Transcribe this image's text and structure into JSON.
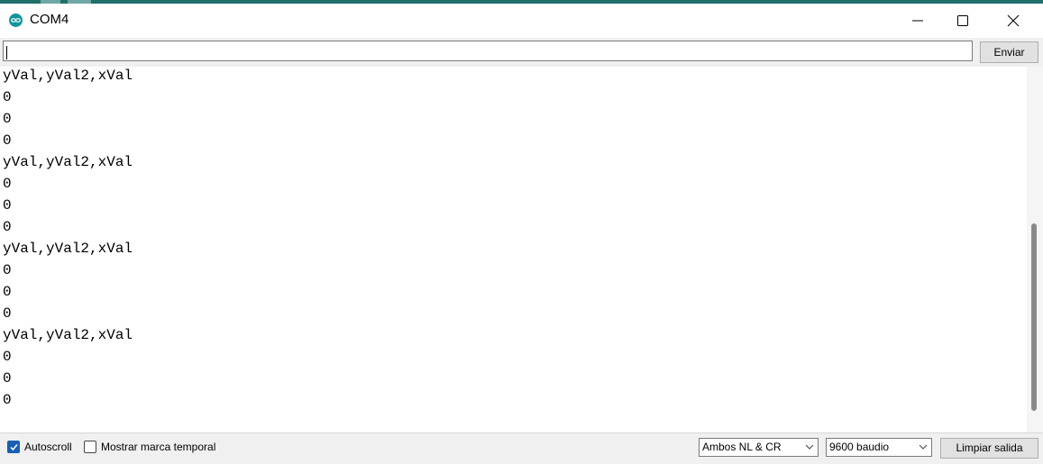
{
  "window": {
    "title": "COM4",
    "app_icon": "arduino-icon",
    "controls": [
      "minimize-icon",
      "maximize-icon",
      "close-icon"
    ]
  },
  "send": {
    "input_value": "",
    "button_label": "Enviar"
  },
  "output": {
    "lines": [
      "yVal,yVal2,xVal",
      "0",
      "0",
      "0",
      "yVal,yVal2,xVal",
      "0",
      "0",
      "0",
      "yVal,yVal2,xVal",
      "0",
      "0",
      "0",
      "yVal,yVal2,xVal",
      "0",
      "0",
      "0"
    ]
  },
  "footer": {
    "autoscroll": {
      "label": "Autoscroll",
      "checked": true
    },
    "timestamp": {
      "label": "Mostrar marca temporal",
      "checked": false
    },
    "line_ending": {
      "selected": "Ambos NL & CR"
    },
    "baud_rate": {
      "selected": "9600 baudio"
    },
    "clear_label": "Limpiar salida"
  },
  "colors": {
    "accent": "#1a5fb4",
    "arduino_teal": "#12949e"
  }
}
